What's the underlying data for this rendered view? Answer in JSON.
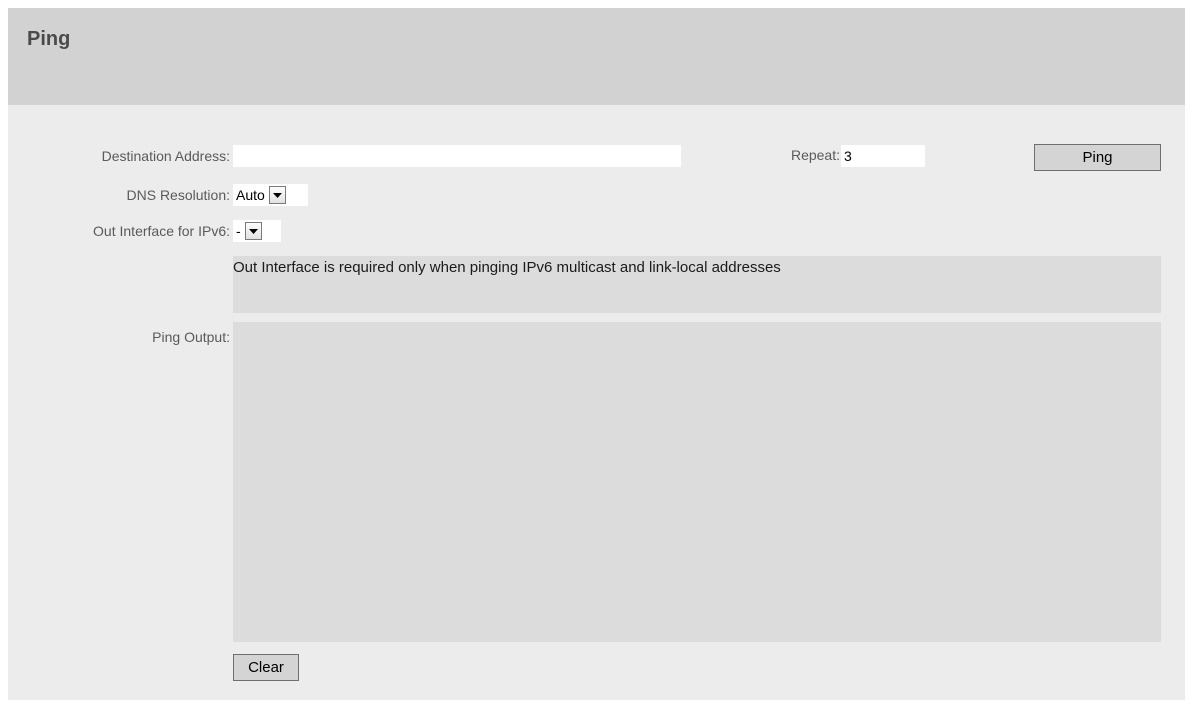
{
  "header": {
    "title": "Ping"
  },
  "form": {
    "destination": {
      "label": "Destination Address:",
      "value": ""
    },
    "repeat": {
      "label": "Repeat:",
      "value": "3"
    },
    "ping_button": {
      "label": "Ping"
    },
    "dns": {
      "label": "DNS Resolution:",
      "value": "Auto"
    },
    "out_interface": {
      "label": "Out Interface for IPv6:",
      "value": "-"
    },
    "note": "Out Interface is required only when pinging IPv6 multicast and link-local addresses",
    "output": {
      "label": "Ping Output:",
      "value": ""
    },
    "clear_button": {
      "label": "Clear"
    }
  },
  "icons": {
    "dropdown": "chevron-down-icon"
  },
  "colors": {
    "header_bg": "#d2d2d2",
    "panel_bg": "#ececec",
    "area_bg": "#dcdcdc",
    "label_text": "#5a5a5a"
  }
}
